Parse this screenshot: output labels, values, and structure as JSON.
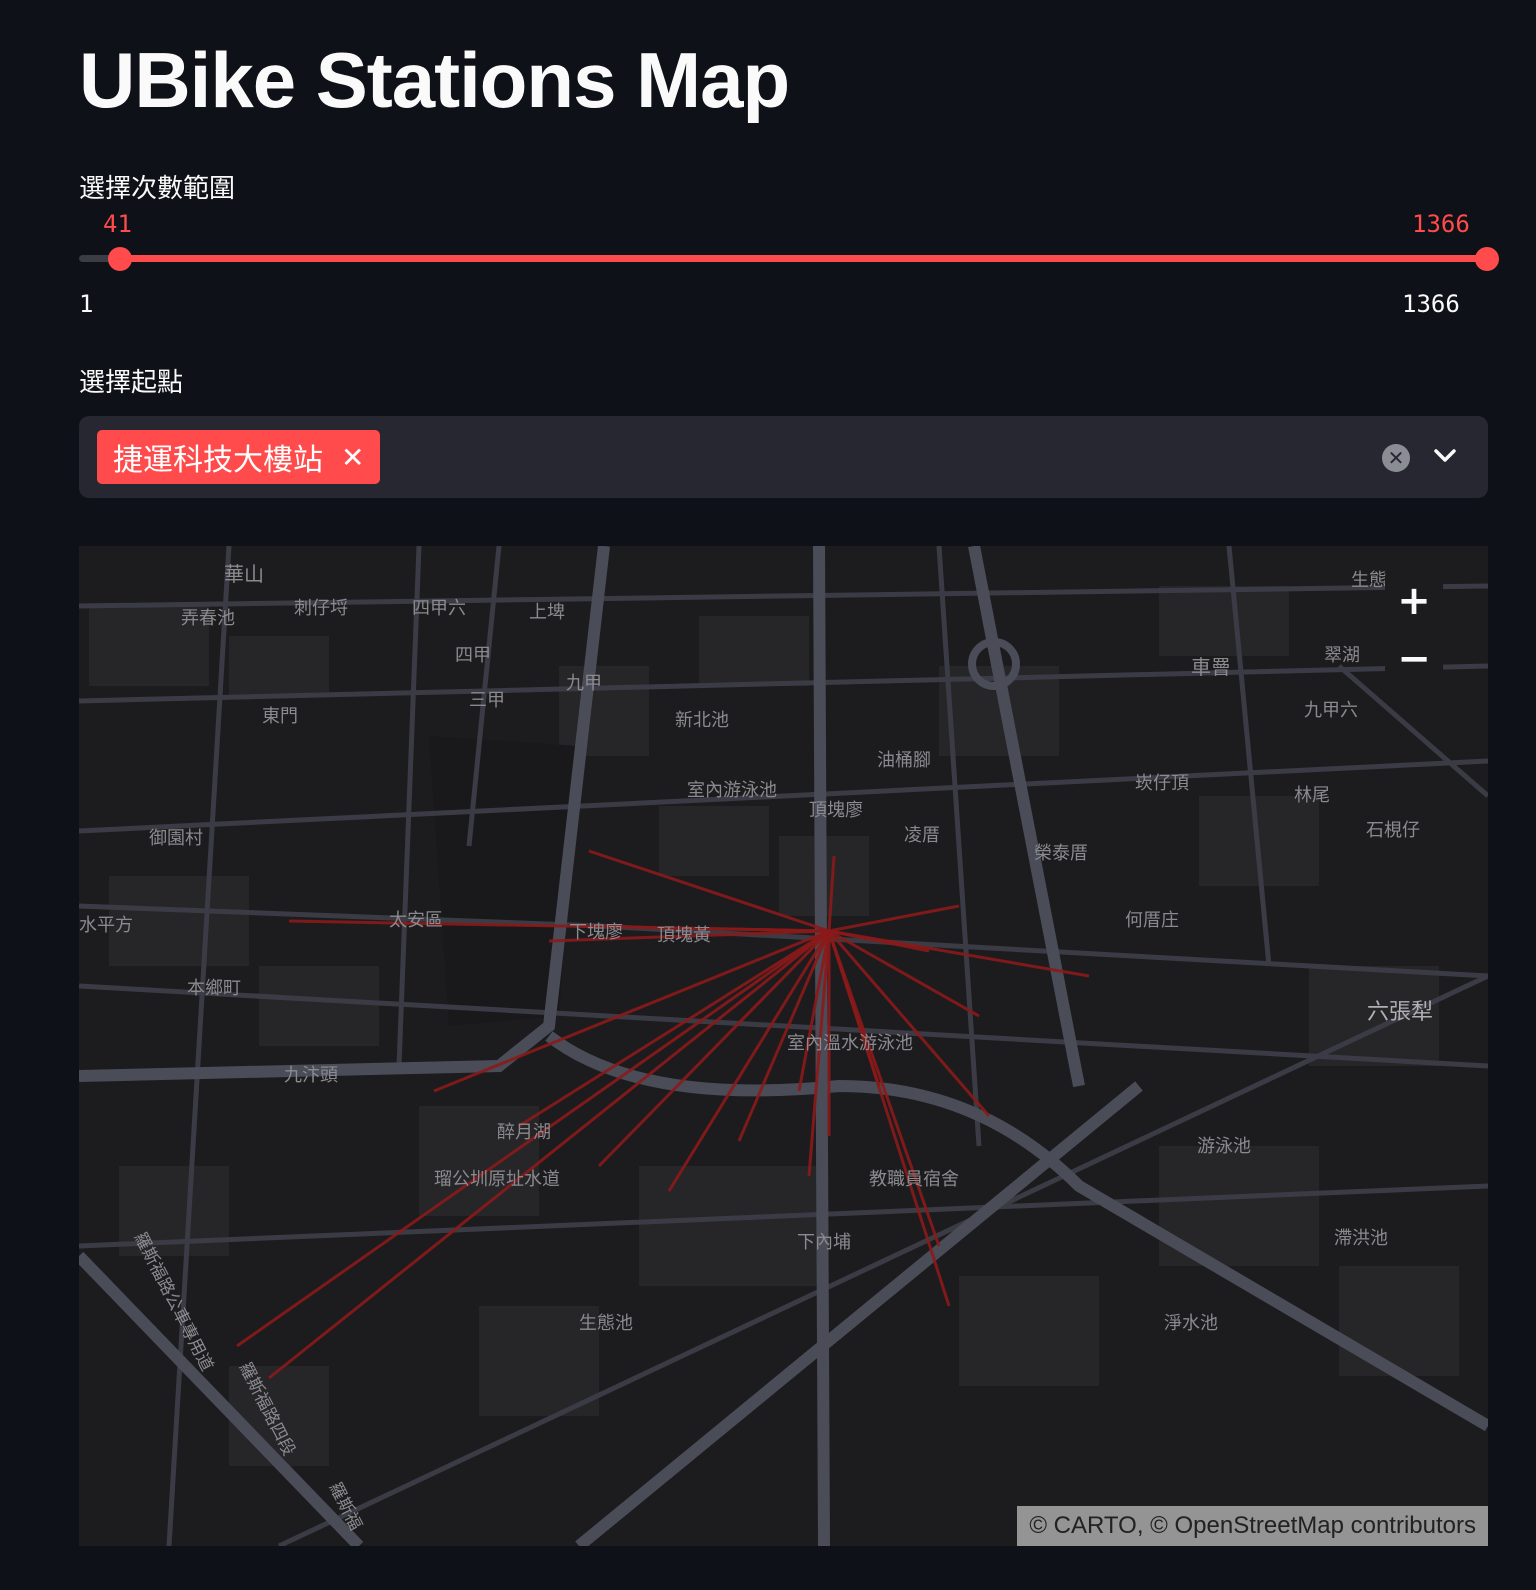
{
  "page": {
    "title": "UBike Stations Map"
  },
  "range_slider": {
    "label": "選擇次數範圍",
    "low_value": "41",
    "high_value": "1366",
    "min_label": "1",
    "max_label": "1366",
    "low_fraction": 0.0293,
    "high_fraction": 1.0,
    "accent_color": "#ff4b4b"
  },
  "start_select": {
    "label": "選擇起點",
    "selected": [
      "捷運科技大樓站"
    ],
    "remove_icon": "close-icon",
    "clear_icon": "clear-circle-icon",
    "open_icon": "chevron-down-icon"
  },
  "map": {
    "basemap": "dark",
    "places": [
      "華山",
      "弄春池",
      "刺仔埒",
      "四甲六",
      "上埤",
      "生態",
      "四甲",
      "九甲",
      "三甲",
      "車罾",
      "翠湖",
      "東門",
      "新北池",
      "九甲六",
      "油桶腳",
      "崁仔頂",
      "林尾",
      "室內游泳池",
      "頂塊廖",
      "凌厝",
      "石梘仔",
      "御園村",
      "榮泰厝",
      "何厝庄",
      "水平方",
      "太安區",
      "下塊廖",
      "頂塊黃",
      "本鄉町",
      "六張犁",
      "室內溫水游泳池",
      "九汴頭",
      "醉月湖",
      "游泳池",
      "瑠公圳原址水道",
      "教職員宿舍",
      "滯洪池",
      "下內埔",
      "生態池",
      "淨水池",
      "羅斯福路公車專用道",
      "羅斯福路四段",
      "羅斯福"
    ],
    "zoom_in_label": "+",
    "zoom_out_label": "−",
    "route_color": "#8b1a1a",
    "attribution": "© CARTO, © OpenStreetMap contributors"
  }
}
